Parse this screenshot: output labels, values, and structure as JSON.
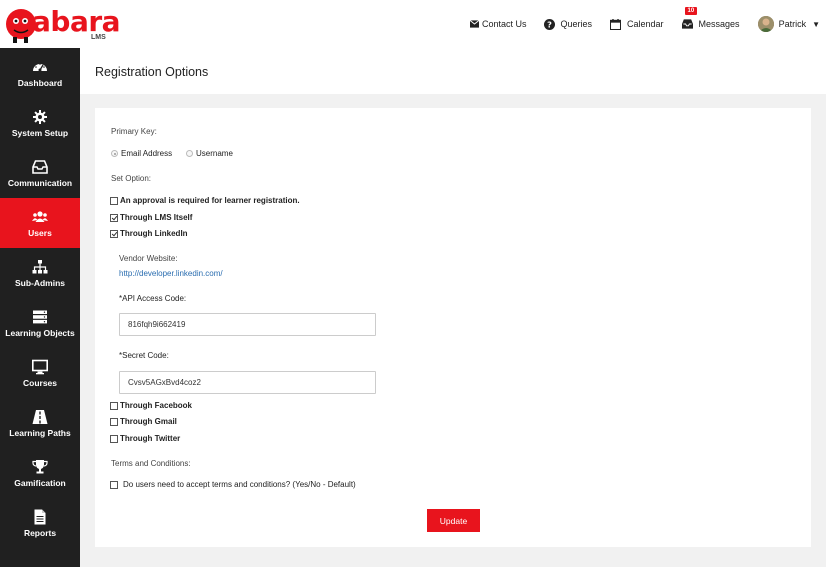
{
  "brand": {
    "logo_text": "abara",
    "logo_sub": "LMS",
    "accent": "#e8141d"
  },
  "topnav": {
    "contact": "Contact Us",
    "queries": "Queries",
    "calendar": "Calendar",
    "messages": "Messages",
    "messages_badge": "10",
    "user": "Patrick"
  },
  "sidebar": {
    "items": [
      {
        "label": "Dashboard",
        "icon": "dashboard-icon"
      },
      {
        "label": "System Setup",
        "icon": "gear-icon"
      },
      {
        "label": "Communication",
        "icon": "inbox-icon"
      },
      {
        "label": "Users",
        "icon": "users-icon",
        "active": true
      },
      {
        "label": "Sub-Admins",
        "icon": "sitemap-icon"
      },
      {
        "label": "Learning Objects",
        "icon": "server-icon"
      },
      {
        "label": "Courses",
        "icon": "monitor-icon"
      },
      {
        "label": "Learning Paths",
        "icon": "road-icon"
      },
      {
        "label": "Gamification",
        "icon": "trophy-icon"
      },
      {
        "label": "Reports",
        "icon": "file-icon"
      }
    ]
  },
  "page": {
    "title": "Registration Options"
  },
  "form": {
    "primary_key_label": "Primary Key:",
    "pk_email": "Email Address",
    "pk_username": "Username",
    "set_option_label": "Set Option:",
    "approval": "An approval is required for learner registration.",
    "through_lms": "Through LMS Itself",
    "through_linkedin": "Through LinkedIn",
    "vendor_label": "Vendor Website:",
    "vendor_url": "http://developer.linkedin.com/",
    "api_label": "*API Access Code:",
    "api_value": "816fqh9i662419",
    "secret_label": "*Secret Code:",
    "secret_value": "Cvsv5AGxBvd4coz2",
    "through_facebook": "Through Facebook",
    "through_gmail": "Through Gmail",
    "through_twitter": "Through Twitter",
    "terms_label": "Terms and Conditions:",
    "terms_question": "Do users need to accept terms and conditions? (Yes/No - Default)",
    "update_button": "Update"
  }
}
